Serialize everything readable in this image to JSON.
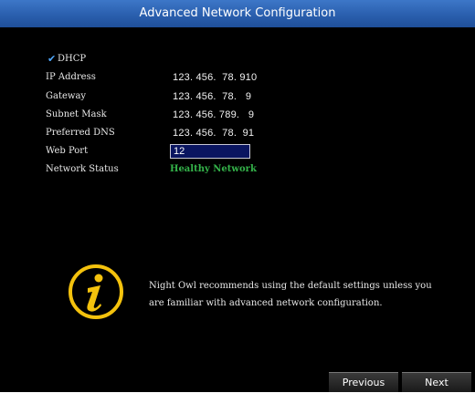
{
  "window": {
    "title": "Advanced Network Configuration"
  },
  "dhcp": {
    "label": "DHCP",
    "checked": true,
    "icon": "checkmark-icon"
  },
  "fields": {
    "ip_address": {
      "label": "IP Address",
      "value": "123. 456.  78. 910"
    },
    "gateway": {
      "label": "Gateway",
      "value": "123. 456.  78.   9"
    },
    "subnet_mask": {
      "label": "Subnet Mask",
      "value": "123. 456. 789.   9"
    },
    "preferred_dns": {
      "label": "Preferred DNS",
      "value": "123. 456.  78.  91"
    },
    "web_port": {
      "label": "Web Port",
      "value": "12"
    },
    "network_status": {
      "label": "Network Status",
      "value": "Healthy Network",
      "color": "#34b34a"
    }
  },
  "info": {
    "icon": "info-icon",
    "text": "Night Owl recommends using the default settings unless you are familiar with advanced network configuration."
  },
  "buttons": {
    "previous": "Previous",
    "next": "Next"
  },
  "colors": {
    "titlebar": "#2a5fae",
    "accent_check": "#4fa8ff",
    "status_ok": "#34b34a",
    "icon_yellow": "#f4c20d"
  }
}
